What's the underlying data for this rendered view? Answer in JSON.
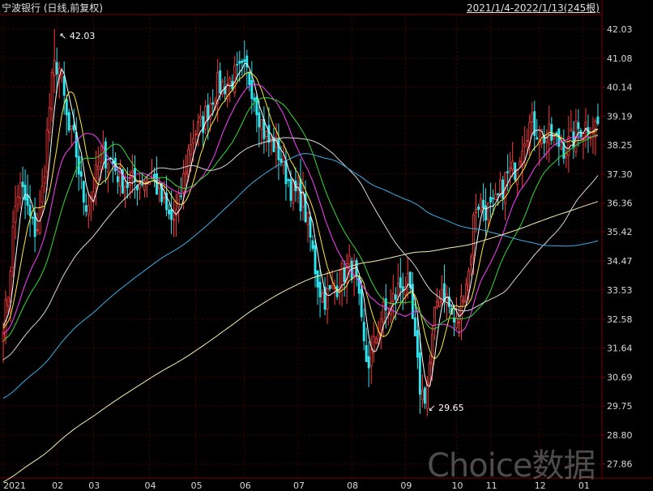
{
  "header": {
    "title": "宁波银行 (日线,前复权)",
    "range": "2021/1/4-2022/1/13(245根)"
  },
  "watermark": "Choice数据",
  "annotations": {
    "high_label": "42.03",
    "low_label": "29.65"
  },
  "chart_data": {
    "type": "candlestick",
    "title": "宁波银行 (日线,前复权)",
    "range_text": "2021/1/4-2022/1/13(245根)",
    "ylim": [
      27.4,
      42.5
    ],
    "y_ticks": [
      42.03,
      41.08,
      40.14,
      39.19,
      38.25,
      37.3,
      36.36,
      35.42,
      34.47,
      33.53,
      32.58,
      31.64,
      30.69,
      29.75,
      28.8,
      27.86
    ],
    "x_ticks": [
      "2021",
      "02",
      "03",
      "04",
      "05",
      "06",
      "07",
      "08",
      "09",
      "10",
      "11",
      "12",
      "01"
    ],
    "month_keypoints": [
      {
        "m": 0,
        "v": 32.6
      },
      {
        "m": 0.3,
        "v": 36.8
      },
      {
        "m": 0.6,
        "v": 35.5
      },
      {
        "m": 1.0,
        "v": 40.9
      },
      {
        "m": 1.4,
        "v": 38.5
      },
      {
        "m": 1.8,
        "v": 36.4
      },
      {
        "m": 2.2,
        "v": 37.9
      },
      {
        "m": 2.6,
        "v": 37.0
      },
      {
        "m": 3.0,
        "v": 37.2
      },
      {
        "m": 3.5,
        "v": 35.8
      },
      {
        "m": 4.0,
        "v": 38.7
      },
      {
        "m": 4.5,
        "v": 40.2
      },
      {
        "m": 5.0,
        "v": 40.6
      },
      {
        "m": 5.5,
        "v": 38.3
      },
      {
        "m": 6.0,
        "v": 36.6
      },
      {
        "m": 6.5,
        "v": 33.3
      },
      {
        "m": 7.0,
        "v": 34.3
      },
      {
        "m": 7.3,
        "v": 31.2
      },
      {
        "m": 7.6,
        "v": 32.8
      },
      {
        "m": 8.0,
        "v": 33.8
      },
      {
        "m": 8.35,
        "v": 30.1
      },
      {
        "m": 8.7,
        "v": 33.6
      },
      {
        "m": 9.0,
        "v": 32.4
      },
      {
        "m": 9.3,
        "v": 33.9
      },
      {
        "m": 9.6,
        "v": 36.4
      },
      {
        "m": 10.0,
        "v": 36.1
      },
      {
        "m": 10.4,
        "v": 37.3
      },
      {
        "m": 10.8,
        "v": 38.9
      },
      {
        "m": 11.2,
        "v": 38.5
      },
      {
        "m": 11.6,
        "v": 38.2
      },
      {
        "m": 12.0,
        "v": 38.9
      },
      {
        "m": 12.4,
        "v": 38.1
      }
    ],
    "bar_count": 245,
    "high": 42.03,
    "low": 29.65,
    "moving_averages": [
      {
        "period": 5,
        "color": "#ffffff"
      },
      {
        "period": 10,
        "color": "#ffeb3b"
      },
      {
        "period": 20,
        "color": "#ff40ff"
      },
      {
        "period": 30,
        "color": "#33dd33"
      },
      {
        "period": 60,
        "color": "#d8d8d8"
      },
      {
        "period": 120,
        "color": "#3bb0e8"
      },
      {
        "period": 250,
        "color": "#f5f0b0"
      }
    ],
    "colors": {
      "up": "#ff3c3c",
      "down": "#2fe6f0",
      "grid": "#4a0000",
      "axis": "#7a0000"
    },
    "grid": true
  }
}
